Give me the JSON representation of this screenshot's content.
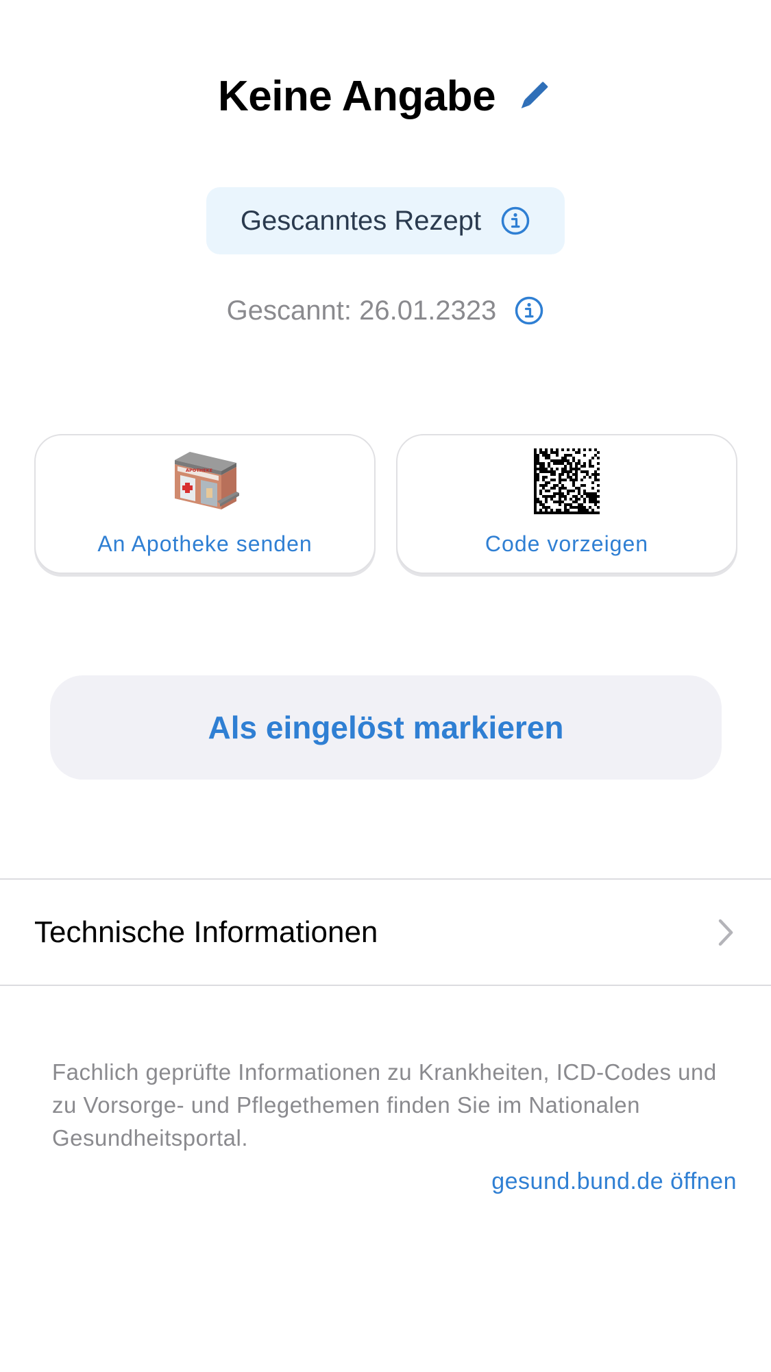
{
  "header": {
    "title": "Keine Angabe",
    "edit_icon": "pencil-icon"
  },
  "badge": {
    "label": "Gescanntes Rezept",
    "icon": "info-circle-icon"
  },
  "scanned": {
    "label": "Gescannt: 26.01.2323",
    "icon": "info-circle-icon"
  },
  "actions": {
    "pharmacy": {
      "label": "An Apotheke senden",
      "icon": "pharmacy-building-icon",
      "sign_text": "APOTHEKE"
    },
    "code": {
      "label": "Code vorzeigen",
      "icon": "datamatrix-code-icon"
    }
  },
  "redeem_button": {
    "label": "Als eingelöst markieren"
  },
  "tech_info": {
    "label": "Technische Informationen",
    "icon": "chevron-right-icon"
  },
  "footer": {
    "text": "Fachlich geprüfte Informationen zu Krankheiten, ICD-Codes und zu Vorsorge- und Pflegethemen finden Sie im Nationalen Gesundheitsportal.",
    "link": "gesund.bund.de öffnen"
  },
  "colors": {
    "accent": "#2f7fd3",
    "badge_background": "#eaf5fd",
    "button_background": "#f1f1f6",
    "secondary_text": "#8a8a8e"
  }
}
